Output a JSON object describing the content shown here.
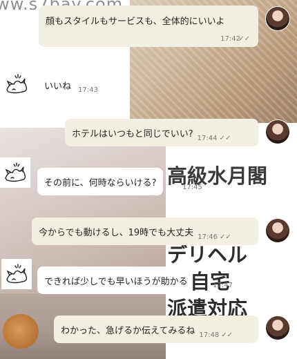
{
  "background": {
    "watermark": "ww.s7bay.com",
    "ad_lines": [
      "高級水月閣",
      "デリヘル",
      "・自宅",
      "派遣対応"
    ]
  },
  "colors": {
    "sent_bubble": "#f3f0e3",
    "received_bubble": "#ffffff",
    "time_text": "#777777"
  },
  "messages": [
    {
      "id": "m1",
      "direction": "sent",
      "text": "顔もスタイルもサービスも、全体的にいいよ",
      "time": "17:42",
      "read_icon": "double-check-icon",
      "read_mark": "✓✓"
    },
    {
      "id": "m2",
      "direction": "received",
      "text": "いいね",
      "time": "17:43"
    },
    {
      "id": "m3",
      "direction": "sent",
      "text": "ホテルはいつもと同じでいい?",
      "time": "17:44",
      "read_icon": "double-check-icon",
      "read_mark": "✓✓"
    },
    {
      "id": "m4",
      "direction": "received",
      "text": "その前に、何時ならいける?",
      "time": "17:45"
    },
    {
      "id": "m5",
      "direction": "sent",
      "text": "今からでも動けるし、19時でも大丈夫",
      "time": "17:46",
      "read_icon": "double-check-icon",
      "read_mark": "✓✓"
    },
    {
      "id": "m6",
      "direction": "received",
      "text": "できれば少しでも早いほうが助かる",
      "time": "17:47"
    },
    {
      "id": "m7",
      "direction": "sent",
      "text": "わかった、急げるか伝えてみるね",
      "time": "17:48",
      "read_icon": "double-check-icon",
      "read_mark": "✓✓"
    }
  ]
}
